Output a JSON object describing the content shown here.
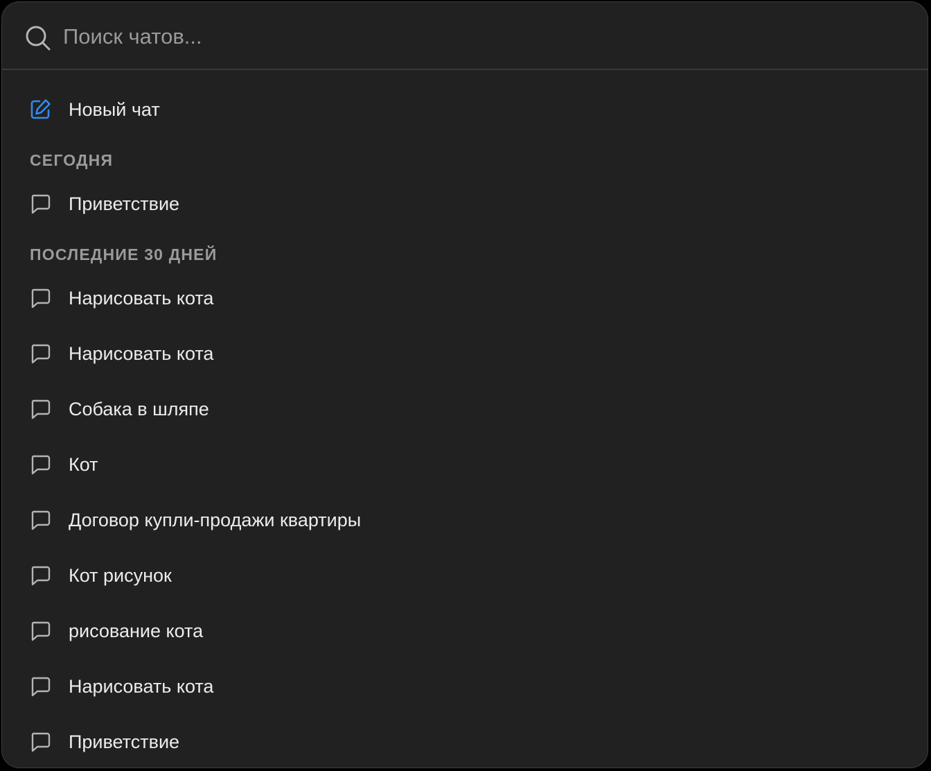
{
  "search": {
    "placeholder": "Поиск чатов...",
    "icon": "search-icon"
  },
  "new_chat": {
    "label": "Новый чат",
    "icon": "new-chat-icon",
    "accent_color": "#2f8cf0"
  },
  "sections": [
    {
      "title": "СЕГОДНЯ",
      "items": [
        {
          "label": "Приветствие"
        }
      ]
    },
    {
      "title": "ПОСЛЕДНИЕ 30 ДНЕЙ",
      "items": [
        {
          "label": "Нарисовать кота"
        },
        {
          "label": "Нарисовать кота"
        },
        {
          "label": "Собака в шляпе"
        },
        {
          "label": "Кот"
        },
        {
          "label": "Договор купли-продажи квартиры"
        },
        {
          "label": "Кот рисунок"
        },
        {
          "label": "рисование кота"
        },
        {
          "label": "Нарисовать кота"
        },
        {
          "label": "Приветствие"
        }
      ]
    }
  ],
  "colors": {
    "background": "#212121",
    "text": "#ececec",
    "muted": "#9b9b9b"
  }
}
